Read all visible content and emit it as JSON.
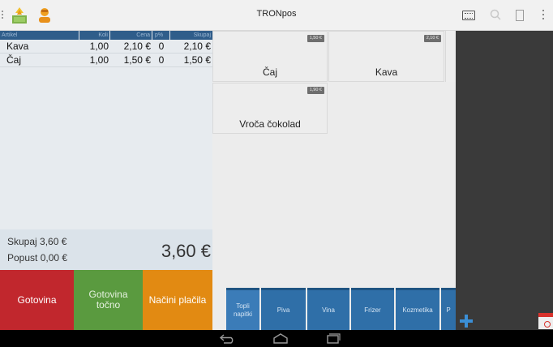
{
  "app": {
    "title": "TRONpos"
  },
  "actionbar": {
    "icons": [
      "app-launcher-icon",
      "user-icon",
      "keyboard-icon",
      "search-icon",
      "document-icon",
      "overflow-menu-icon"
    ]
  },
  "order": {
    "headers": {
      "article": "Artikel",
      "qty": "Koli",
      "price": "Cena",
      "discount": "p%",
      "total": "Skupaj"
    },
    "rows": [
      {
        "article": "Kava",
        "qty": "1,00",
        "price": "2,10 €",
        "discount": "0",
        "total": "2,10 €"
      },
      {
        "article": "Čaj",
        "qty": "1,00",
        "price": "1,50 €",
        "discount": "0",
        "total": "1,50 €"
      }
    ]
  },
  "totals": {
    "sum_label": "Skupaj 3,60 €",
    "discount_label": "Popust 0,00 €",
    "grand_total": "3,60 €"
  },
  "payment": {
    "cash": "Gotovina",
    "exact_cash": "Gotovina točno",
    "methods": "Načini plačila"
  },
  "products": [
    {
      "name": "Čaj",
      "price": "1,50 €"
    },
    {
      "name": "Kava",
      "price": "2,10 €"
    },
    {
      "name": "Vroča čokolad",
      "price": "1,90 €"
    }
  ],
  "categories": [
    {
      "label": "Topli napitki"
    },
    {
      "label": "Piva"
    },
    {
      "label": "Vina"
    },
    {
      "label": "Frizer"
    },
    {
      "label": "Kozmetika"
    },
    {
      "label": "P"
    }
  ],
  "colors": {
    "header_blue": "#2f5d8a",
    "cash_red": "#c1272d",
    "exact_green": "#5a9a3f",
    "methods_orange": "#e28a12",
    "category_blue": "#2f6fa8",
    "panel_dark": "#3a3a3a"
  }
}
